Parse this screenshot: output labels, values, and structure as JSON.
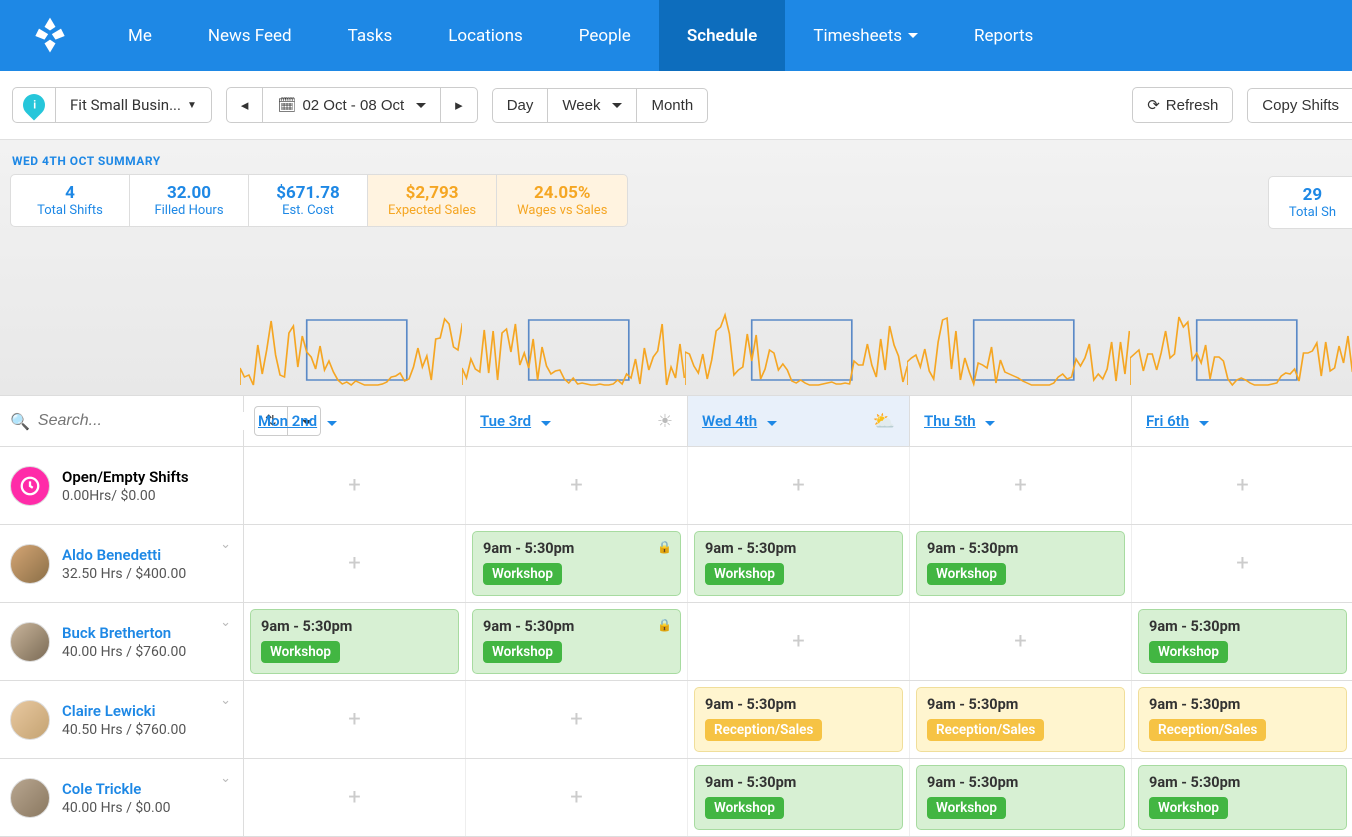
{
  "nav": {
    "items": [
      {
        "label": "Me"
      },
      {
        "label": "News Feed"
      },
      {
        "label": "Tasks"
      },
      {
        "label": "Locations"
      },
      {
        "label": "People"
      },
      {
        "label": "Schedule",
        "active": true
      },
      {
        "label": "Timesheets",
        "dropdown": true
      },
      {
        "label": "Reports"
      }
    ]
  },
  "toolbar": {
    "location": "Fit Small Busin...",
    "date_range": "02 Oct - 08 Oct",
    "view_day": "Day",
    "view_week": "Week",
    "view_month": "Month",
    "refresh": "Refresh",
    "copy_shifts": "Copy Shifts"
  },
  "summary": {
    "title": "WED 4TH OCT SUMMARY",
    "cards": [
      {
        "big": "4",
        "lbl": "Total Shifts"
      },
      {
        "big": "32.00",
        "lbl": "Filled Hours"
      },
      {
        "big": "$671.78",
        "lbl": "Est. Cost"
      },
      {
        "big": "$2,793",
        "lbl": "Expected Sales",
        "orange": true
      },
      {
        "big": "24.05%",
        "lbl": "Wages vs Sales",
        "orange": true
      }
    ],
    "right_card": {
      "big": "29",
      "lbl": "Total Sh"
    }
  },
  "days": [
    {
      "label": "Mon 2nd",
      "key": "mon"
    },
    {
      "label": "Tue 3rd",
      "key": "tue",
      "weather": "sun"
    },
    {
      "label": "Wed 4th",
      "key": "wed",
      "highlight": true,
      "weather": "cloud"
    },
    {
      "label": "Thu 5th",
      "key": "thu"
    },
    {
      "label": "Fri 6th",
      "key": "fri"
    }
  ],
  "search": {
    "placeholder": "Search..."
  },
  "employees": [
    {
      "name": "Open/Empty Shifts",
      "sub": "0.00Hrs/ $0.00",
      "open": true,
      "shifts": {}
    },
    {
      "name": "Aldo Benedetti",
      "sub": "32.50 Hrs / $400.00",
      "avatar": "aldo",
      "shifts": {
        "tue": {
          "time": "9am - 5:30pm",
          "tag": "Workshop",
          "type": "green",
          "locked": true
        },
        "wed": {
          "time": "9am - 5:30pm",
          "tag": "Workshop",
          "type": "green"
        },
        "thu": {
          "time": "9am - 5:30pm",
          "tag": "Workshop",
          "type": "green"
        }
      }
    },
    {
      "name": "Buck Bretherton",
      "sub": "40.00 Hrs / $760.00",
      "avatar": "buck",
      "shifts": {
        "mon": {
          "time": "9am - 5:30pm",
          "tag": "Workshop",
          "type": "green"
        },
        "tue": {
          "time": "9am - 5:30pm",
          "tag": "Workshop",
          "type": "green",
          "locked": true
        },
        "fri": {
          "time": "9am - 5:30pm",
          "tag": "Workshop",
          "type": "green"
        }
      }
    },
    {
      "name": "Claire Lewicki",
      "sub": "40.50 Hrs / $760.00",
      "avatar": "claire",
      "shifts": {
        "wed": {
          "time": "9am - 5:30pm",
          "tag": "Reception/Sales",
          "type": "yellow"
        },
        "thu": {
          "time": "9am - 5:30pm",
          "tag": "Reception/Sales",
          "type": "yellow"
        },
        "fri": {
          "time": "9am - 5:30pm",
          "tag": "Reception/Sales",
          "type": "yellow"
        }
      }
    },
    {
      "name": "Cole Trickle",
      "sub": "40.00 Hrs / $0.00",
      "avatar": "cole",
      "shifts": {
        "wed": {
          "time": "9am - 5:30pm",
          "tag": "Workshop",
          "type": "green"
        },
        "thu": {
          "time": "9am - 5:30pm",
          "tag": "Workshop",
          "type": "green"
        },
        "fri": {
          "time": "9am - 5:30pm",
          "tag": "Workshop",
          "type": "green"
        }
      }
    }
  ]
}
